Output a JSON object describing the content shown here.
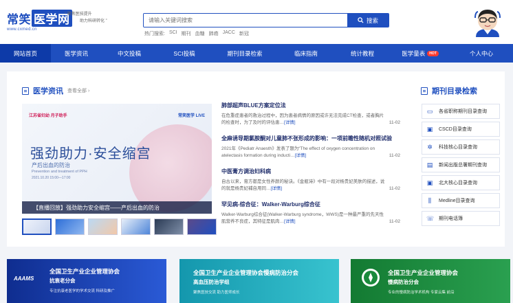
{
  "logo": {
    "name": "常笑医学网",
    "name_prefix": "常笑",
    "name_box": "医学网",
    "url": "www.cxmed.cn"
  },
  "slogan": {
    "line1": "“ 聚焦医技提升",
    "line2": "助力科研转化 ”"
  },
  "search": {
    "placeholder": "请输入关键词搜索",
    "button": "搜索",
    "hot_label": "热门搜索:",
    "hot_terms": [
      "SCI",
      "期刊",
      "血糖",
      "肺癌",
      "JACC",
      "新冠"
    ]
  },
  "nav": {
    "items": [
      "网站首页",
      "医学资讯",
      "中文投稿",
      "SCI投稿",
      "期刊目录检索",
      "临床指南",
      "统计教程",
      "医学量表",
      "个人中心"
    ],
    "hot_badge": "HOT",
    "active_index": 0,
    "colors": {
      "bar": "#1f4fbf",
      "active": "#0d3aa8"
    }
  },
  "news_section": {
    "title": "医学资讯",
    "more": "查看全部 ›"
  },
  "banner": {
    "brand": "江苏省妇幼 月子助手",
    "logo2": "常笑医学 LIVE",
    "headline": "强劲助力·安全缩宫",
    "sub1": "产后出血的防治",
    "sub2": "Prevention and treatment of PPH",
    "sub3": "2021.10.20 15:00—17:00",
    "caption": "【直播回放】强劲助力安全缩宫——产后出血的防治"
  },
  "news": [
    {
      "title": "肺部超声BLUE方案定位法",
      "desc": "在危重症患者的救治过程中，因为患者病情的原因或许无法完成CT检查，或者胸片的检查时，为了及时的评估患…",
      "detail": "[详情]",
      "date": "11-02"
    },
    {
      "title": "全麻诱导期氯胺酮对儿童肺不张形成的影响：一项前瞻性随机对照试验",
      "desc": "2021年《Pediatr Anaesth》发表了题为“The effect of oxygen concentration on atelectasis formation during inducti…",
      "detail": "[详情]",
      "date": "11-02"
    },
    {
      "title": "中医膏方调治妇科病",
      "desc": "自古以来，膏方都是女性养颜的秘诀。《金瓶诗》中有一段对杨贵妃美肤的描述，说的就是杨贵妃補自用同…",
      "detail": "[详情]",
      "date": "11-02"
    },
    {
      "title": "罕见病-综合征：Walker-Warburg综合征",
      "desc": "Walker-Warburg综合征(Walker-Warburg syndrome，WWS)是一种最严重的先天性肌营养不良症，其特征是肌肉…",
      "detail": "[详情]",
      "date": "11-02"
    }
  ],
  "side_section": {
    "title": "期刊目录检索",
    "items": [
      {
        "label": "各省职称期刊目录查询",
        "icon": "folder-icon",
        "glyph": "▭"
      },
      {
        "label": "CSCD目录查询",
        "icon": "book-icon",
        "glyph": "▣"
      },
      {
        "label": "科技核心目录查询",
        "icon": "atom-icon",
        "glyph": "✲"
      },
      {
        "label": "新闻出版总署期刊查询",
        "icon": "document-icon",
        "glyph": "▤"
      },
      {
        "label": "北大核心目录查询",
        "icon": "book-icon",
        "glyph": "▣"
      },
      {
        "label": "Medline目录查询",
        "icon": "library-icon",
        "glyph": "⫼"
      },
      {
        "label": "期刊电话簿",
        "icon": "phone-icon",
        "glyph": "☏"
      }
    ]
  },
  "promos": [
    {
      "t1": "全国卫生产业企业管理协会",
      "t2": "抗衰老分会",
      "t3": "专注抗衰老医学的学术交流 科研及推广",
      "mark": "AAAMS",
      "color": "#1c3fb0"
    },
    {
      "t1": "全国卫生产业企业管理协会慢病防治分会",
      "t2": "高血压防治学组",
      "t3": "聚焦医技交流 助力医师成长",
      "mark": "",
      "color": "#1aa7b8"
    },
    {
      "t1": "全国卫生产业企业管理协会",
      "t2": "慢病防治分会",
      "t3": "专业的慢病防治学术机构 专家云集 前沿",
      "mark": "",
      "color": "#1a8a3c"
    }
  ]
}
